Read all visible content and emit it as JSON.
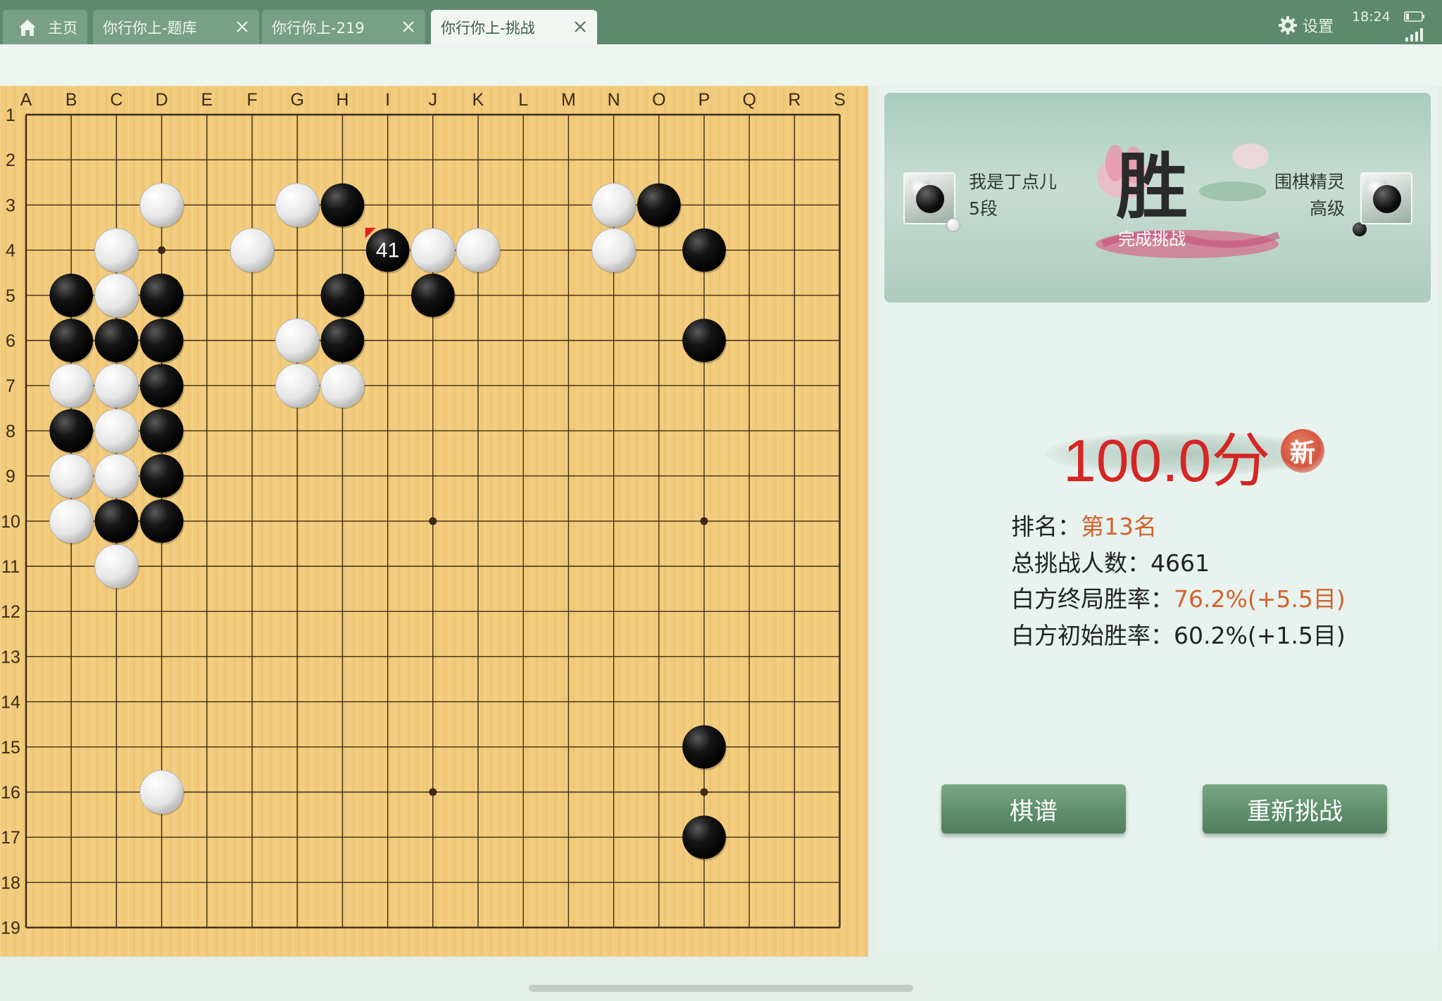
{
  "tabs": {
    "home": {
      "label": "主页",
      "icon": "home-icon"
    },
    "items": [
      {
        "label": "你行你上-题库",
        "active": false
      },
      {
        "label": "你行你上-219",
        "active": false
      },
      {
        "label": "你行你上-挑战",
        "active": true
      }
    ]
  },
  "status": {
    "settings_label": "设置",
    "time": "18:24"
  },
  "board": {
    "size": 19,
    "columns": [
      "A",
      "B",
      "C",
      "D",
      "E",
      "F",
      "G",
      "H",
      "I",
      "J",
      "K",
      "L",
      "M",
      "N",
      "O",
      "P",
      "Q",
      "R",
      "S"
    ],
    "rows": [
      "1",
      "2",
      "3",
      "4",
      "5",
      "6",
      "7",
      "8",
      "9",
      "10",
      "11",
      "12",
      "13",
      "14",
      "15",
      "16",
      "17",
      "18",
      "19"
    ],
    "star_points": [
      "D4",
      "J10",
      "P10",
      "J16",
      "P16"
    ],
    "last_move": {
      "point": "I4",
      "number": "41"
    },
    "black_stones": [
      "H3",
      "O3",
      "I4",
      "P4",
      "B5",
      "D5",
      "H5",
      "J5",
      "B6",
      "C6",
      "D6",
      "H6",
      "P6",
      "D7",
      "B8",
      "D8",
      "D9",
      "C10",
      "D10",
      "P15",
      "P17"
    ],
    "white_stones": [
      "D3",
      "G3",
      "N3",
      "C4",
      "F4",
      "J4",
      "K4",
      "N4",
      "C5",
      "G6",
      "B7",
      "C7",
      "G7",
      "H7",
      "C8",
      "B9",
      "C9",
      "B10",
      "C11",
      "D16"
    ]
  },
  "result": {
    "left_player": {
      "name": "我是丁点儿",
      "rank": "5段",
      "stone": "white"
    },
    "right_player": {
      "name": "围棋精灵",
      "rank": "高级",
      "stone": "black"
    },
    "outcome_char": "胜",
    "outcome_label": "完成挑战",
    "score": "100.0分",
    "new_badge": "新",
    "rank_label": "排名：",
    "rank_value": "第13名",
    "total_label": "总挑战人数：",
    "total_value": "4661",
    "final_rate_label": "白方终局胜率：",
    "final_rate_value": "76.2%(+5.5目)",
    "initial_rate_label": "白方初始胜率：",
    "initial_rate_value": "60.2%(+1.5目)"
  },
  "buttons": {
    "record": "棋谱",
    "retry": "重新挑战"
  },
  "colors": {
    "topbar": "#5d8a6c",
    "board": "#f2cb7b",
    "score": "#d42625",
    "highlight": "#d2642e",
    "button": "#5e8e6a"
  }
}
